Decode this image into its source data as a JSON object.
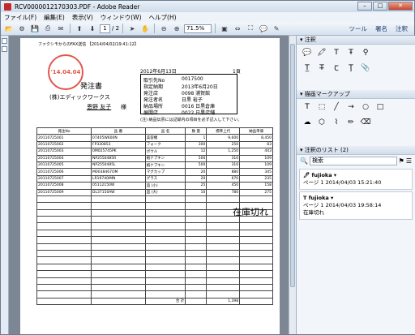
{
  "window": {
    "title": "RCV0000012170303.PDF - Adobe Reader"
  },
  "menu": [
    "ファイル(F)",
    "編集(E)",
    "表示(V)",
    "ウィンドウ(W)",
    "ヘルプ(H)"
  ],
  "toolbar": {
    "page_current": "1",
    "page_total": "/ 2",
    "zoom": "71.5%",
    "tabs": [
      "ツール",
      "署名",
      "注釈"
    ]
  },
  "doc": {
    "fax_header": "ファクシモからのFAX送信 【2014/04/02/19:41:12】",
    "date": "2012年6月13日",
    "page_no": "1頁",
    "title": "発注書",
    "company": "(株)エディックワークス",
    "recipient": "恩野 友子",
    "recipient_suffix": "様",
    "stamp": "'14.04.04",
    "info": [
      {
        "label": "取引先No",
        "value": "0017500"
      },
      {
        "label": "指定納期",
        "value": "2013年6月20日"
      },
      {
        "label": "発注店",
        "value": "0098 浦賀館"
      },
      {
        "label": "発注者名",
        "value": "日黒 裕子"
      },
      {
        "label": "納品場所",
        "value": "0016 日黒倉庫"
      },
      {
        "label": "展開店",
        "value": "0022 日黒店舗"
      }
    ],
    "note": "(注) 納品伝票には記録内の項目を必ず記入して下さい。",
    "columns": [
      "発注No",
      "品 番",
      "品 名",
      "数 量",
      "標準上代",
      "納品単価"
    ],
    "rows": [
      [
        "20110725001",
        "07405W600N",
        "美容機",
        "1",
        "9,600",
        "8,450"
      ],
      [
        "20110725002",
        "FP330853",
        "フォーク",
        "300",
        "250",
        "83"
      ],
      [
        "20110725003",
        "0M025745PK",
        "ボウル",
        "12",
        "1,250",
        "443"
      ],
      [
        "20110725004",
        "NP2550485R",
        "紙ナプキン",
        "500",
        "310",
        "109"
      ],
      [
        "20110725005",
        "NP2550485L",
        "紙ナプキン",
        "500",
        "310",
        "109"
      ],
      [
        "20110725006",
        "M0038467OM",
        "マグカップ",
        "20",
        "880",
        "345"
      ],
      [
        "20110725007",
        "LR19740IMN",
        "グラス",
        "20",
        "670",
        "235"
      ],
      [
        "20110725008",
        "05112150W",
        "皿 (小)",
        "25",
        "450",
        "158"
      ],
      [
        "20110725009",
        "DL37150AW",
        "皿 (大)",
        "10",
        "780",
        "275"
      ]
    ],
    "total_label": "合 計",
    "total_value": "1,398",
    "annotation": "在庫切れ"
  },
  "panel": {
    "annotations_title": "注釈",
    "markup_title": "描画マークアップ",
    "list_title": "注釈のリスト (2)",
    "search_placeholder": "検索",
    "comments": [
      {
        "author": "fujioka",
        "meta": "ページ 1  2014/04/03 15:21:40",
        "text": ""
      },
      {
        "author": "fujioka",
        "meta": "ページ 1  2014/04/03 19:58:14",
        "text": "在庫切れ"
      }
    ]
  }
}
